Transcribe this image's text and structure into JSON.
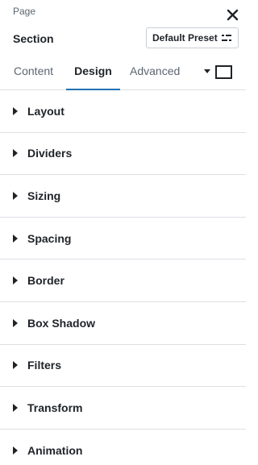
{
  "header": {
    "breadcrumb": "Page",
    "title": "Section",
    "close_icon": "close-icon",
    "preset": {
      "label": "Default Preset",
      "icon": "preset-options-icon"
    }
  },
  "tabs": [
    {
      "label": "Content",
      "active": false
    },
    {
      "label": "Design",
      "active": true
    },
    {
      "label": "Advanced",
      "active": false
    }
  ],
  "device": {
    "icon": "desktop-icon",
    "caret_icon": "caret-down-icon"
  },
  "accent_color": "#2271b1",
  "panels": [
    {
      "label": "Layout"
    },
    {
      "label": "Dividers"
    },
    {
      "label": "Sizing"
    },
    {
      "label": "Spacing"
    },
    {
      "label": "Border"
    },
    {
      "label": "Box Shadow"
    },
    {
      "label": "Filters"
    },
    {
      "label": "Transform"
    },
    {
      "label": "Animation"
    }
  ]
}
